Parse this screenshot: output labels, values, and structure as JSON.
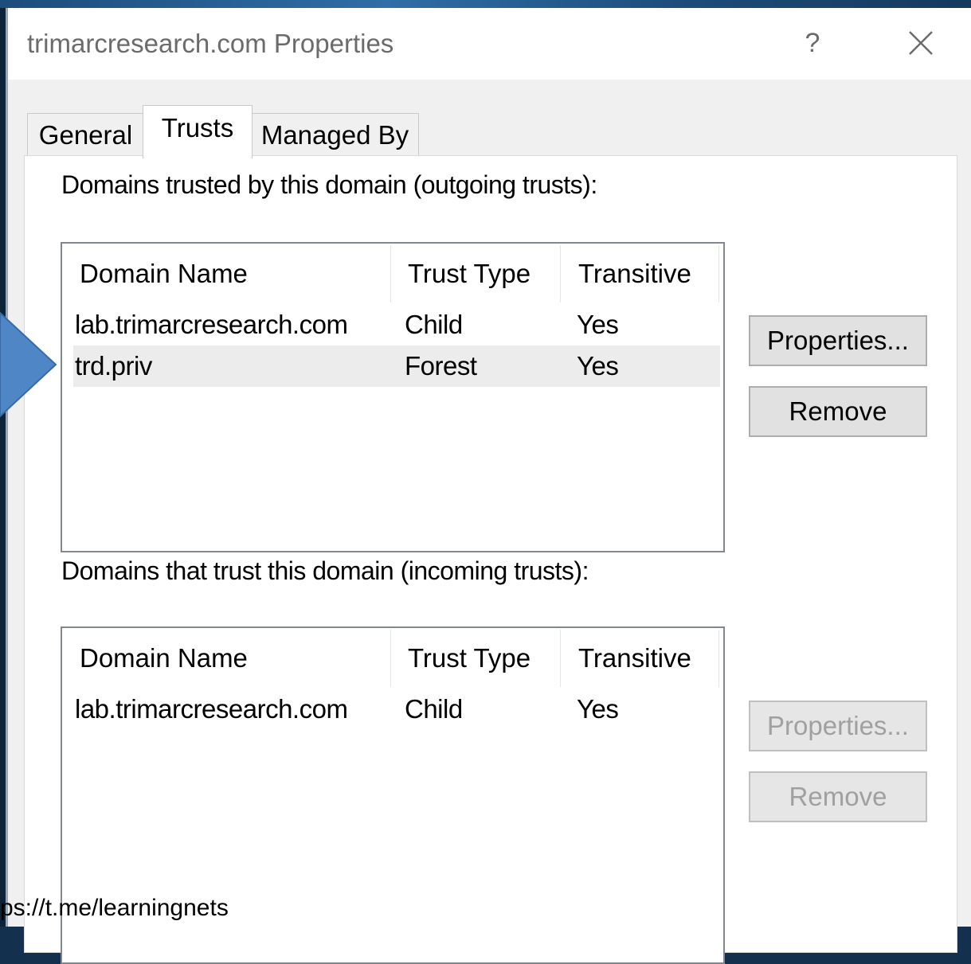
{
  "window": {
    "title": "trimarcresearch.com Properties",
    "help_label": "?"
  },
  "tabs": [
    {
      "label": "General"
    },
    {
      "label": "Trusts"
    },
    {
      "label": "Managed By"
    }
  ],
  "active_tab": "Trusts",
  "outgoing": {
    "label": "Domains trusted by this domain (outgoing trusts):",
    "columns": [
      "Domain Name",
      "Trust Type",
      "Transitive"
    ],
    "rows": [
      {
        "domain": "lab.trimarcresearch.com",
        "type": "Child",
        "transitive": "Yes"
      },
      {
        "domain": "trd.priv",
        "type": "Forest",
        "transitive": "Yes",
        "selected": true
      }
    ],
    "properties_label": "Properties...",
    "remove_label": "Remove"
  },
  "incoming": {
    "label": "Domains that trust this domain (incoming trusts):",
    "columns": [
      "Domain Name",
      "Trust Type",
      "Transitive"
    ],
    "rows": [
      {
        "domain": "lab.trimarcresearch.com",
        "type": "Child",
        "transitive": "Yes"
      }
    ],
    "properties_label": "Properties...",
    "remove_label": "Remove"
  },
  "watermark": "ps://t.me/learningnets",
  "colors": {
    "arrow_fill": "#4f86c6",
    "arrow_stroke": "#3a6aa3",
    "selected_row": "#ececec"
  }
}
